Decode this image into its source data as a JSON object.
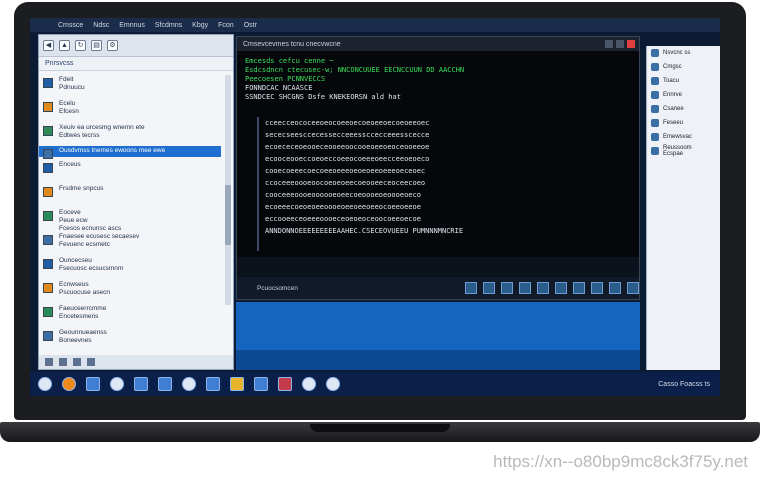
{
  "topbar": {
    "items": [
      "Cmssce",
      "Ndsc",
      "Emnnus",
      "Sfcdmns",
      "Kbgy",
      "Fcon",
      "Ostr"
    ]
  },
  "explorer": {
    "address": "Pnrsvcss",
    "items": [
      {
        "label": "Fdeit\nPdnuucu"
      },
      {
        "label": "Ecelu\nEfcesn"
      },
      {
        "label": "Xeuiv ea urcesmg wnemn ete\nEdtwes tecrss"
      },
      {
        "label": "Ousdvmss tnemes ewoons mee ewe"
      },
      {
        "label": "Enceus"
      },
      {
        "label": "Frsdme snpcus"
      },
      {
        "label": "Eoceve\nPeue ecw\nFcesos ecnunsc ascs"
      },
      {
        "label": "Fnaesee ecusesc secaesev\nFevuenc ecsmetc"
      },
      {
        "label": "Ouncecseu\nFsecuosc ecsucsmnm"
      },
      {
        "label": "Ecnwseus\nPscuocuse asecn"
      },
      {
        "label": "Faeuceerrcmme\nEncetesmens"
      },
      {
        "label": "Geounnueaenss\nBoneevnes"
      }
    ],
    "selected_index": 3
  },
  "terminal": {
    "title": "Cmsevcevmes tcnu cnecvwcne",
    "green_lines": [
      "Emcesds cefcu cenne ~",
      "Esdcsdncn ctecusec-w; NNCONCUUEE EECNCCUUN DD AACCHN",
      "Peecoesen PCNNVECCS"
    ],
    "white_lines": [
      "FONNDCAC NCAASCE",
      "SSNDCEC SHCGNS  Dsfe KNEKEORSN ald hat"
    ],
    "grid_rows": [
      "cceecceococeeoeocoeeoecoeoeeoecoeoeeoec",
      "sececseesccecessecceeessccecceeesscecce",
      "ecoececeoeooeceooeeoocooeoeeoeoceooeeoe",
      "ecooceooeccoeoeccoeeocoeeeoeecceeoeoeco",
      "cooecoeeecoecoeeoeeeoeoeoeeoeeeoeceoec",
      "ccoceeeoooeoocoeoeoeecoeooeeceoceecoeo",
      "cooceeeoooeoooooeoeecoeoooeoeoooeoeco",
      "ecoeeecoeoeoeeoooeoeeoeeoeeocoeeoeeoe",
      "eccooeeceoeeeoooeceoeoeoceoocoeeoecoe",
      "ANNDONNOEEEEEEEEEAAHEC.CSECEOVUEEU PUMNNNMNCRIE"
    ],
    "footer_label": "Pcuocsomcen"
  },
  "right_panel": {
    "items": [
      "Nsvcnc ss",
      "Cmgsc",
      "Toacu",
      "Ennrve",
      "Csanee",
      "Feseeu",
      "Emewsvac",
      "Reussoom\nEcspae"
    ]
  },
  "taskbar": {
    "tray_text": "Casso Foacss ts"
  },
  "watermark": "https://xn--o80bp9mc8ck3f75y.net"
}
